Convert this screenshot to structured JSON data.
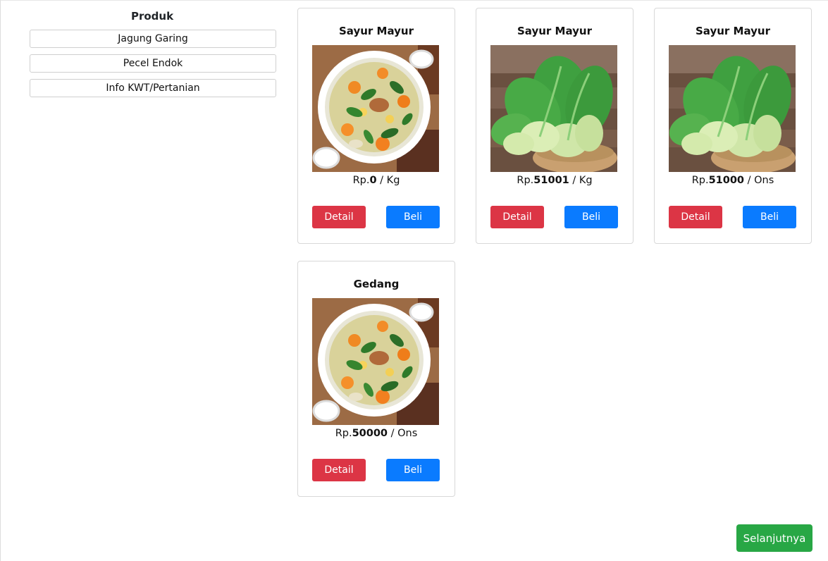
{
  "sidebar": {
    "title": "Produk",
    "items": [
      {
        "label": "Jagung Garing"
      },
      {
        "label": "Pecel Endok"
      },
      {
        "label": "Info KWT/Pertanian"
      }
    ]
  },
  "products": [
    {
      "name": "Sayur Mayur",
      "image": "vegetable-soup-image",
      "currency": "Rp.",
      "price": "0",
      "unit": " / Kg",
      "detail_label": "Detail",
      "buy_label": "Beli"
    },
    {
      "name": "Sayur Mayur",
      "image": "bok-choy-image",
      "currency": "Rp.",
      "price": "51001",
      "unit": " / Kg",
      "detail_label": "Detail",
      "buy_label": "Beli"
    },
    {
      "name": "Sayur Mayur",
      "image": "bok-choy-image",
      "currency": "Rp.",
      "price": "51000",
      "unit": " / Ons",
      "detail_label": "Detail",
      "buy_label": "Beli"
    },
    {
      "name": "Gedang",
      "image": "vegetable-soup-image",
      "currency": "Rp.",
      "price": "50000",
      "unit": " / Ons",
      "detail_label": "Detail",
      "buy_label": "Beli"
    }
  ],
  "pagination": {
    "next_label": "Selanjutnya"
  },
  "colors": {
    "detail_button": "#dc3545",
    "buy_button": "#0a7bff",
    "next_button": "#28a745"
  }
}
